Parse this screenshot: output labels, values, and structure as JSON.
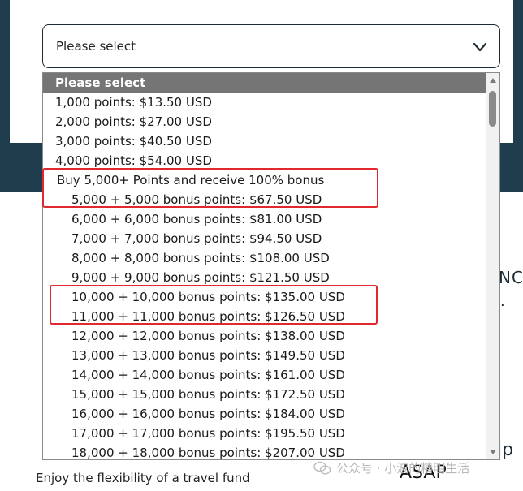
{
  "select": {
    "value": "Please select",
    "icon": "chevron-down-icon"
  },
  "dropdown": {
    "options": [
      {
        "label": "Please select",
        "kind": "selected"
      },
      {
        "label": "1,000 points: $13.50 USD",
        "kind": "option"
      },
      {
        "label": "2,000 points: $27.00 USD",
        "kind": "option"
      },
      {
        "label": "3,000 points: $40.50 USD",
        "kind": "option"
      },
      {
        "label": "4,000 points: $54.00 USD",
        "kind": "option"
      },
      {
        "label": "Buy 5,000+ Points and receive 100% bonus",
        "kind": "group"
      },
      {
        "label": "5,000 + 5,000 bonus points: $67.50 USD",
        "kind": "indent"
      },
      {
        "label": "6,000 + 6,000 bonus points: $81.00 USD",
        "kind": "indent"
      },
      {
        "label": "7,000 + 7,000 bonus points: $94.50 USD",
        "kind": "indent"
      },
      {
        "label": "8,000 + 8,000 bonus points: $108.00 USD",
        "kind": "indent"
      },
      {
        "label": "9,000 + 9,000 bonus points: $121.50 USD",
        "kind": "indent"
      },
      {
        "label": "10,000 + 10,000 bonus points: $135.00 USD",
        "kind": "indent"
      },
      {
        "label": "11,000 + 11,000 bonus points: $126.50 USD",
        "kind": "indent"
      },
      {
        "label": "12,000 + 12,000 bonus points: $138.00 USD",
        "kind": "indent"
      },
      {
        "label": "13,000 + 13,000 bonus points: $149.50 USD",
        "kind": "indent"
      },
      {
        "label": "14,000 + 14,000 bonus points: $161.00 USD",
        "kind": "indent"
      },
      {
        "label": "15,000 + 15,000 bonus points: $172.50 USD",
        "kind": "indent"
      },
      {
        "label": "16,000 + 16,000 bonus points: $184.00 USD",
        "kind": "indent"
      },
      {
        "label": "17,000 + 17,000 bonus points: $195.50 USD",
        "kind": "indent"
      },
      {
        "label": "18,000 + 18,000 bonus points: $207.00 USD",
        "kind": "indent"
      }
    ]
  },
  "background": {
    "right_text_1": "NC",
    "right_text_2": "·",
    "right_text_3": "ip",
    "enjoy_text": "Enjoy the flexibility of a travel fund",
    "asap_text": "ASAP"
  },
  "watermark": {
    "text": "公众号 · 小波的精明生活",
    "icon": "wechat-icon"
  },
  "colors": {
    "page_band": "#1f3d4d",
    "selected_option_bg": "#757575",
    "highlight_border": "#e0282e"
  }
}
